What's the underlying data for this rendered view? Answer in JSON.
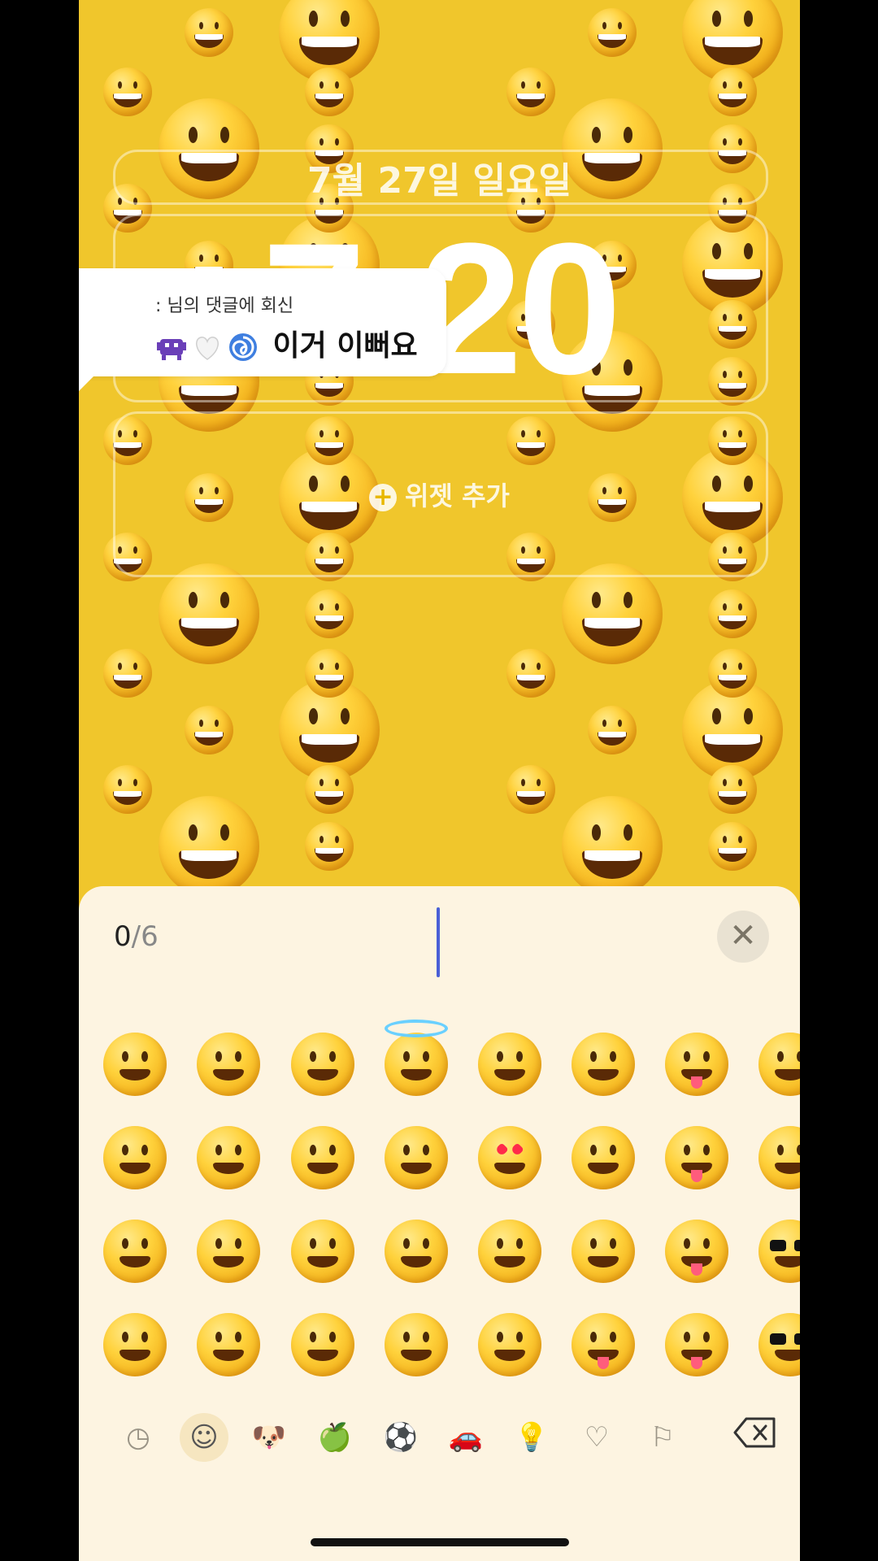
{
  "lock_screen": {
    "date": "7월 27일 일요일",
    "time": "7:20",
    "add_widget": "위젯 추가"
  },
  "reply_bubble": {
    "subtitle": ": 님의 댓글에 회신",
    "message": "이거 이뻐요",
    "icons": [
      "alien-monster-icon",
      "white-heart-icon",
      "cyclone-icon"
    ]
  },
  "emoji_picker": {
    "counter_current": "0",
    "counter_max": "/6",
    "clear_icon": "✕",
    "emojis": [
      "grinning-face",
      "grinning-squinting-face",
      "rolling-laughing-face",
      "smiling-face-with-halo",
      "relieved-face",
      "kissing-face",
      "face-with-tongue",
      "raised-eyebrow-face",
      "grinning-face-big-eyes",
      "pleading-face",
      "holding-back-tears-face",
      "slightly-smiling-face",
      "smiling-face-heart-eyes",
      "kissing-face-smiling-eyes",
      "squinting-face-tongue",
      "face-with-monocle",
      "beaming-face",
      "grinning-face-sweat",
      "smiling-face",
      "upside-down-face",
      "smiling-face-hearts",
      "kissing-face-closed-eyes",
      "winking-face-tongue",
      "nerd-face",
      "beaming-face-smiling-eyes",
      "face-tears-of-joy",
      "smiling-face-smiling-eyes",
      "winking-face",
      "face-blowing-kiss",
      "face-savoring-food",
      "zany-face",
      "smiling-face-sunglasses"
    ],
    "categories": [
      {
        "icon": "recent-clock-icon",
        "glyph": "◷"
      },
      {
        "icon": "smileys-icon",
        "glyph": "☺"
      },
      {
        "icon": "animals-icon",
        "glyph": "🐶"
      },
      {
        "icon": "food-apple-icon",
        "glyph": "🍏"
      },
      {
        "icon": "activity-ball-icon",
        "glyph": "⚽"
      },
      {
        "icon": "travel-car-icon",
        "glyph": "🚗"
      },
      {
        "icon": "objects-bulb-icon",
        "glyph": "💡"
      },
      {
        "icon": "symbols-heart-icon",
        "glyph": "♡"
      },
      {
        "icon": "flags-icon",
        "glyph": "⚐"
      }
    ],
    "active_category": "smileys-icon",
    "backspace_icon": "backspace-icon"
  },
  "colors": {
    "wallpaper": "#f0c62c",
    "sheet": "#fdf4e1",
    "caret": "#4a5fd6"
  }
}
